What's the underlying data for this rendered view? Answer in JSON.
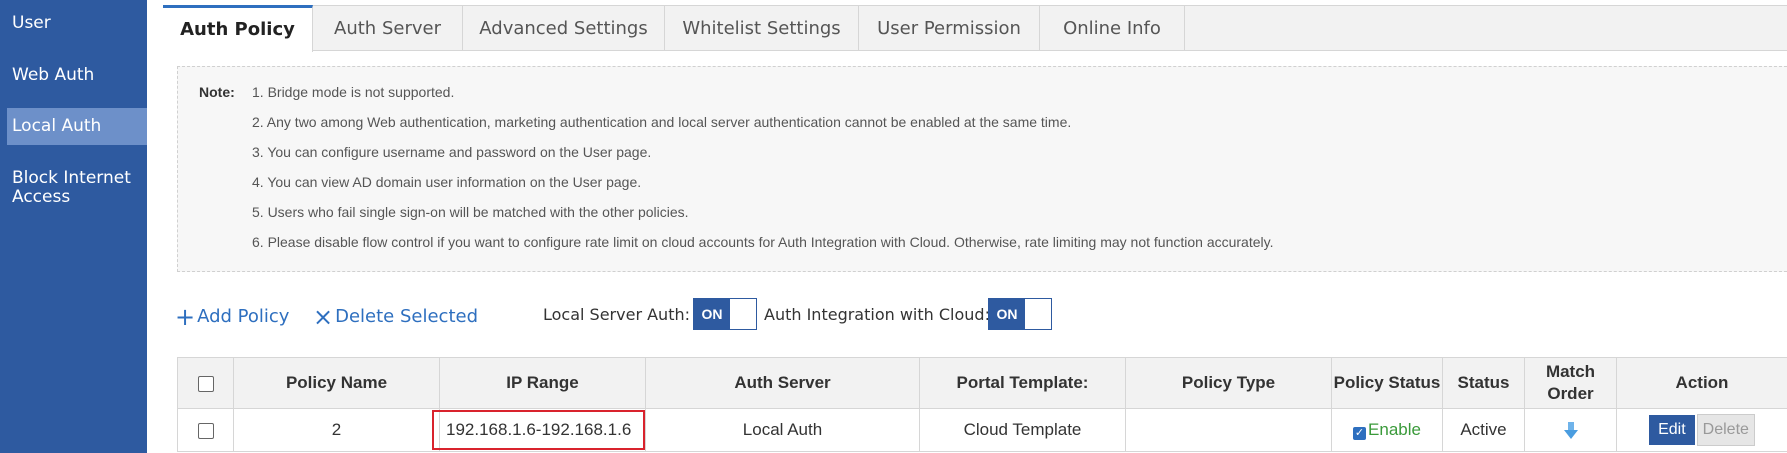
{
  "sidebar": {
    "items": [
      {
        "label": "User"
      },
      {
        "label": "Web Auth"
      },
      {
        "label": "Local Auth",
        "active": true
      },
      {
        "label": "Block Internet Access"
      }
    ]
  },
  "tabs": [
    {
      "label": "Auth Policy",
      "active": true
    },
    {
      "label": "Auth Server"
    },
    {
      "label": "Advanced Settings"
    },
    {
      "label": "Whitelist Settings"
    },
    {
      "label": "User Permission"
    },
    {
      "label": "Online Info"
    }
  ],
  "note": {
    "label": "Note:",
    "lines": [
      "1. Bridge mode is not supported.",
      "2. Any two among Web authentication, marketing authentication and local server authentication cannot be enabled at the same time.",
      "3. You can configure username and password on the User page.",
      "4. You can view AD domain user information on the User page.",
      "5. Users who fail single sign-on will be matched with the other policies.",
      "6. Please disable flow control if you want to configure rate limit on cloud accounts for Auth Integration with Cloud. Otherwise, rate limiting may not function accurately."
    ]
  },
  "toolbar": {
    "add_policy": "Add Policy",
    "delete_selected": "Delete Selected",
    "local_server_auth_label": "Local Server Auth:",
    "local_server_auth_state": "ON",
    "cloud_auth_label": "Auth Integration with Cloud:",
    "cloud_auth_state": "ON"
  },
  "table": {
    "columns": [
      "Policy Name",
      "IP Range",
      "Auth Server",
      "Portal Template:",
      "Policy Type",
      "Policy Status",
      "Status",
      "Match Order",
      "Action"
    ],
    "rows": [
      {
        "policy_name": "2",
        "ip_range": "192.168.1.6-192.168.1.6",
        "auth_server": "Local Auth",
        "portal_template": "Cloud Template",
        "policy_type": "",
        "policy_status": "Enable",
        "status": "Active",
        "edit": "Edit",
        "delete": "Delete"
      }
    ]
  },
  "colors": {
    "sidebar_bg": "#2e5aa0",
    "accent": "#2e6fbf",
    "highlight_box": "#d9232d",
    "enable_text": "#3a9a3a"
  }
}
